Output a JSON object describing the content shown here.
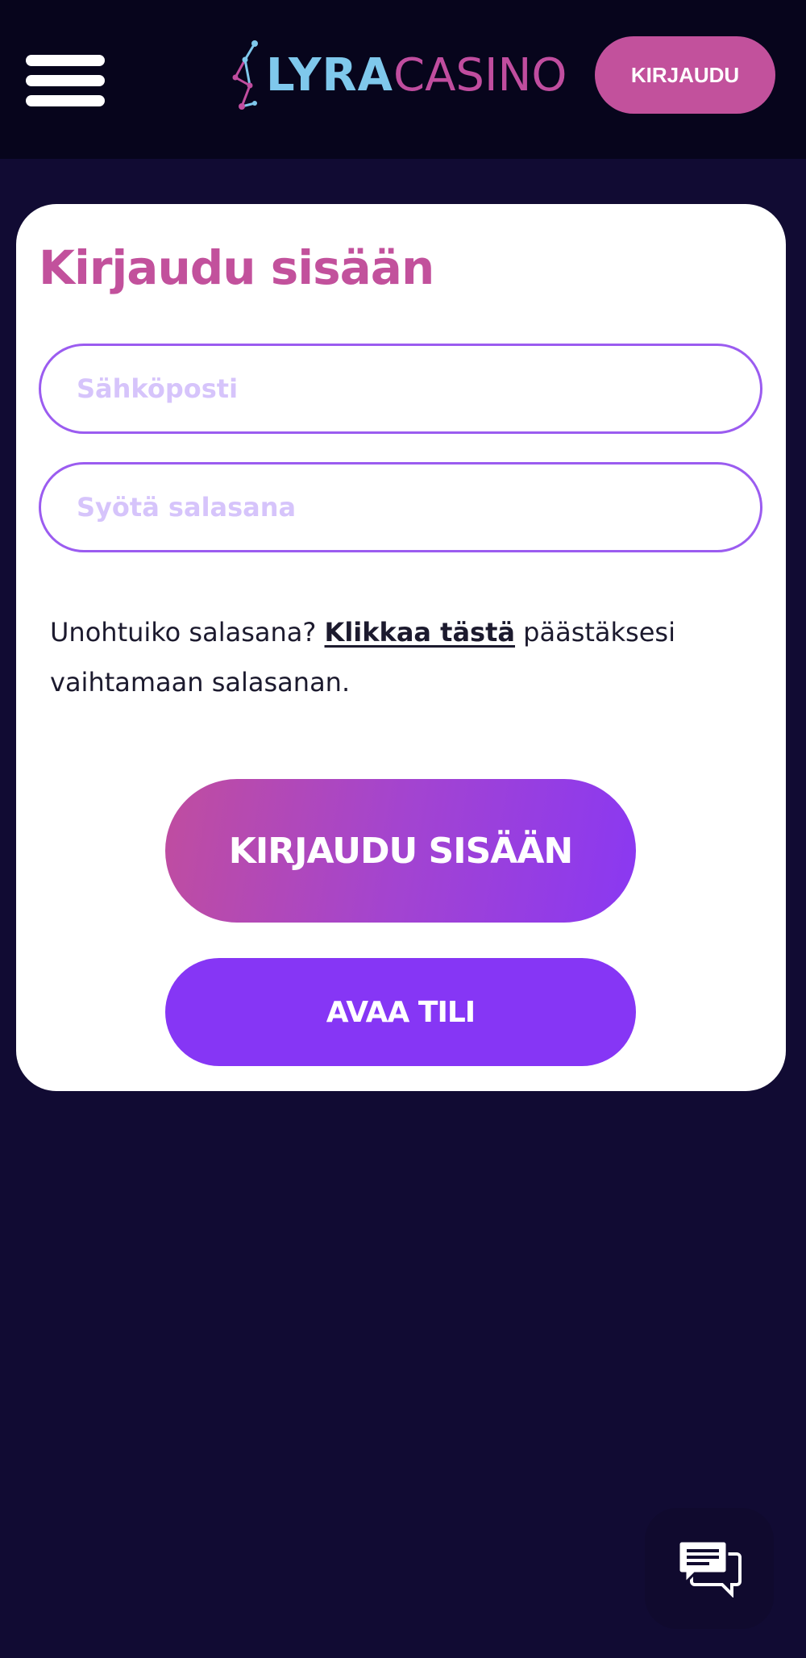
{
  "header": {
    "logo": {
      "part1": "LYRA",
      "part2": "CASINO"
    },
    "login_button": "KIRJAUDU"
  },
  "login_card": {
    "title": "Kirjaudu sisään",
    "email_placeholder": "Sähköposti",
    "password_placeholder": "Syötä salasana",
    "forgot": {
      "prefix": "Unohtuiko salasana? ",
      "link": "Klikkaa tästä",
      "suffix": " päästäksesi vaihtamaan salasanan."
    },
    "submit_button": "KIRJAUDU SISÄÄN",
    "open_account_button": "AVAA TILI"
  },
  "colors": {
    "header_bg": "#07051c",
    "page_bg": "#110b33",
    "brand_pink": "#c2519c",
    "brand_purple": "#8636f5",
    "logo_blue": "#7fc8ec"
  },
  "icons": {
    "menu": "hamburger-icon",
    "logo": "lyra-constellation-icon",
    "chat": "chat-bubbles-icon"
  }
}
